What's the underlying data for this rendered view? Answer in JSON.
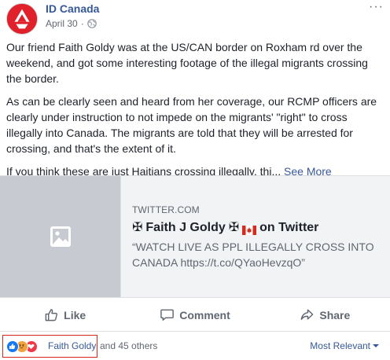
{
  "post": {
    "page_name": "ID Canada",
    "date": "April 30",
    "date_separator": "·",
    "paragraphs": [
      "Our friend Faith Goldy was at the US/CAN border on Roxham rd over the weekend, and got some interesting footage of the illegal migrants crossing the border.",
      "As can be clearly seen and heard from her coverage, our RCMP officers are clearly under instruction to not impede on the migrants' \"right\" to cross illegally into Canada. The migrants are told that they will be arrested for crossing, and that's the extent of it."
    ],
    "truncated_paragraph": "If you think these are just Haitians crossing illegally, thi...",
    "see_more_label": "See More"
  },
  "link_preview": {
    "domain": "TWITTER.COM",
    "title_prefix_symbol": "✠",
    "title_name": "Faith J Goldy",
    "title_mid_symbol": "✠",
    "title_suffix": "on Twitter",
    "description": "“WATCH LIVE AS PPL ILLEGALLY CROSS INTO CANADA https://t.co/QYaoHevzqO”"
  },
  "actions": {
    "like_label": "Like",
    "comment_label": "Comment",
    "share_label": "Share"
  },
  "reactions": {
    "reactor_name": "Faith Goldy",
    "others_text": "and 45 others",
    "sort_label": "Most Relevant",
    "icons": [
      "like-reaction",
      "angry-reaction",
      "love-reaction"
    ]
  },
  "colors": {
    "link_blue": "#365899",
    "highlight_box": "#d6271e",
    "avatar_red": "#e0202a"
  }
}
